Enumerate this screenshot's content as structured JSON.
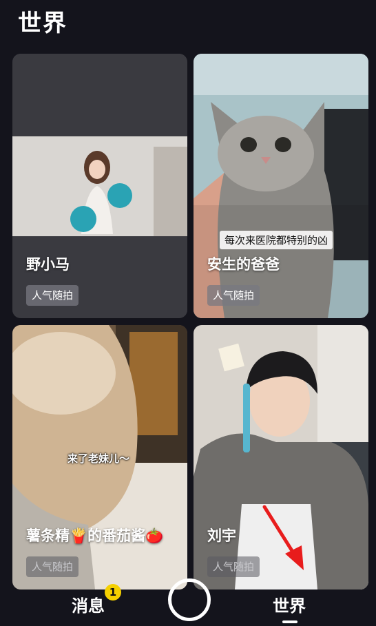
{
  "header": {
    "title": "世界"
  },
  "cards": [
    {
      "name": "野小马",
      "tag": "人气随拍"
    },
    {
      "name": "安生的爸爸",
      "tag": "人气随拍",
      "caption": "每次来医院都特别的凶"
    },
    {
      "name": "薯条精🍟的番茄酱🍅",
      "tag": "人气随拍",
      "caption": "来了老妹儿～"
    },
    {
      "name": "刘宇",
      "tag": "人气随拍"
    }
  ],
  "nav": {
    "messages": "消息",
    "messages_badge": "1",
    "world": "世界"
  },
  "colors": {
    "background": "#14141c",
    "badge": "#f5d000",
    "arrow": "#e81c1c"
  }
}
